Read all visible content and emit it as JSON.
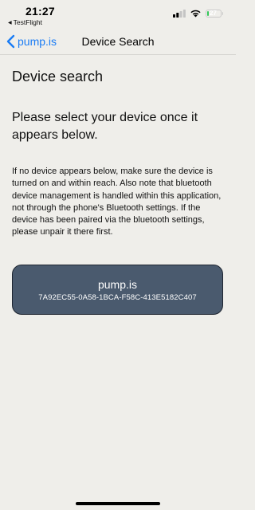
{
  "status_bar": {
    "time": "21:27",
    "back_app_label": "TestFlight",
    "battery_percent": "27",
    "battery_level": 0.27,
    "signal_bars_active": 2,
    "signal_bars_total": 4
  },
  "nav": {
    "back_label": "pump.is",
    "title": "Device Search",
    "accent_color": "#1a7cf5"
  },
  "page": {
    "heading": "Device search",
    "prompt": "Please select your device once it appears below.",
    "help_text": "If no device appears below, make sure the device is turned on and within reach. Also note that bluetooth device management is handled within this application, not through the phone's Bluetooth settings. If the device has been paired via the bluetooth settings, please unpair it there first."
  },
  "devices": [
    {
      "name": "pump.is",
      "id": "7A92EC55-0A58-1BCA-F58C-413E5182C407",
      "card_color": "#4a5a6e"
    }
  ]
}
